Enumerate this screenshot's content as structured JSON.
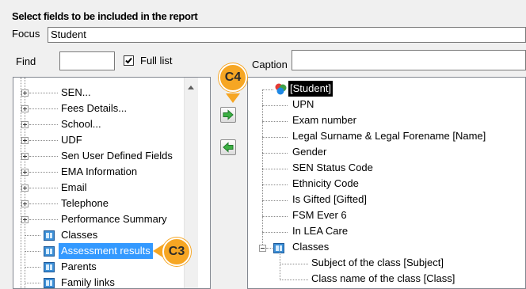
{
  "header": {
    "title": "Select fields to be included in the report"
  },
  "focus": {
    "label": "Focus",
    "value": "Student"
  },
  "find": {
    "label": "Find",
    "value": ""
  },
  "full_list": {
    "label": "Full list",
    "checked": true
  },
  "caption": {
    "label": "Caption",
    "value": ""
  },
  "left_tree": {
    "items": [
      {
        "label": "SEN...",
        "expandable": true
      },
      {
        "label": "Fees Details...",
        "expandable": true
      },
      {
        "label": "School...",
        "expandable": true
      },
      {
        "label": "UDF",
        "expandable": true
      },
      {
        "label": "Sen User Defined Fields",
        "expandable": true
      },
      {
        "label": "EMA Information",
        "expandable": true
      },
      {
        "label": "Email",
        "expandable": true
      },
      {
        "label": "Telephone",
        "expandable": true
      },
      {
        "label": "Performance Summary",
        "expandable": true
      },
      {
        "label": "Classes",
        "icon": "table-icon"
      },
      {
        "label": "Assessment results",
        "icon": "table-icon",
        "selected": true
      },
      {
        "label": "Parents",
        "icon": "table-icon"
      },
      {
        "label": "Family links",
        "icon": "table-icon"
      }
    ]
  },
  "right_tree": {
    "root": {
      "label": "[Student]",
      "icon": "student-icon"
    },
    "fields": [
      "UPN",
      "Exam number",
      "Legal Surname & Legal Forename [Name]",
      "Gender",
      "SEN Status Code",
      "Ethnicity Code",
      "Is Gifted [Gifted]",
      "FSM Ever 6",
      "In LEA Care"
    ],
    "classes": {
      "label": "Classes",
      "children": [
        "Subject of the class [Subject]",
        "Class name of the class [Class]"
      ]
    }
  },
  "buttons": {
    "add_icon": "arrow-right-icon",
    "remove_icon": "arrow-left-icon"
  },
  "callouts": {
    "c3": "C3",
    "c4": "C4"
  },
  "colors": {
    "callout": "#f6a623",
    "selection": "#3399ff",
    "arrow_green": "#3cb043"
  }
}
